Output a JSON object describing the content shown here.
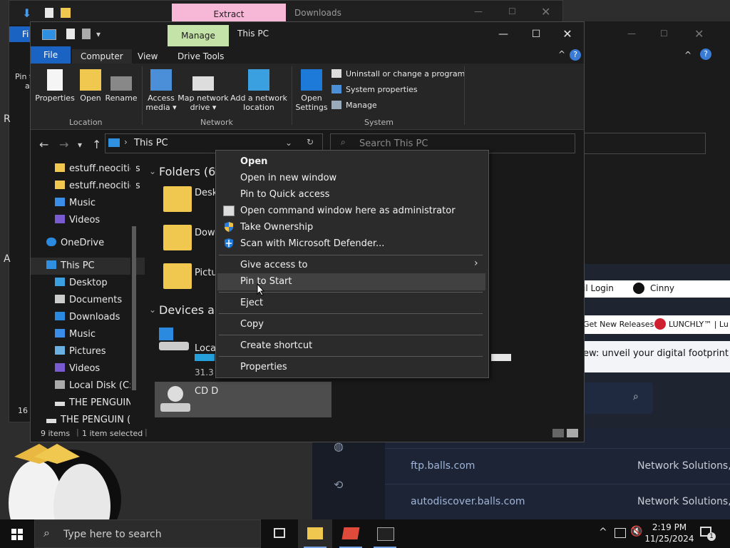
{
  "background": {
    "extract_tab": "Extract",
    "downloads_title": "Downloads",
    "browser": {
      "bookmark_login": "il Login",
      "bookmark_cinny": "Cinny",
      "bookmark_releases": "Get New Releases",
      "bookmark_lunchly": "LUNCHLY™ | Lu",
      "banner_text": "ew: unveil your digital footprint",
      "rows": [
        {
          "host": "ftp.balls.com",
          "org": "Network Solutions, L"
        },
        {
          "host": "autodiscover.balls.com",
          "org": "Network Solutions, L"
        }
      ],
      "dash": "-"
    }
  },
  "explorer": {
    "contextual_tab": "Manage",
    "title": "This PC",
    "menu": {
      "file": "File",
      "computer": "Computer",
      "view": "View",
      "drive_tools": "Drive Tools"
    },
    "ribbon": {
      "location": {
        "label": "Location",
        "properties": "Properties",
        "open": "Open",
        "rename": "Rename"
      },
      "network": {
        "label": "Network",
        "access_media_1": "Access",
        "access_media_2": "media ▾",
        "map_drive_1": "Map network",
        "map_drive_2": "drive ▾",
        "add_location_1": "Add a network",
        "add_location_2": "location"
      },
      "system": {
        "label": "System",
        "open_settings_1": "Open",
        "open_settings_2": "Settings",
        "uninstall": "Uninstall or change a program",
        "system_properties": "System properties",
        "manage": "Manage"
      }
    },
    "address": "This PC",
    "search_placeholder": "Search This PC",
    "nav": {
      "items": [
        "estuff.neocities",
        "estuff.neocities",
        "Music",
        "Videos",
        "OneDrive",
        "This PC",
        "Desktop",
        "Documents",
        "Downloads",
        "Music",
        "Pictures",
        "Videos",
        "Local Disk (C:)",
        "THE PENGUIN",
        "THE PENGUIN ("
      ]
    },
    "content": {
      "folders_header": "Folders (6)",
      "devices_header": "Devices and",
      "folder_desktop": "Deskt",
      "folder_downloads": "Down",
      "folder_pictures": "Pictu",
      "drive_local": "Loca",
      "drive_free": "31.3",
      "drive_cd": "CD D"
    },
    "status": {
      "items": "9 items",
      "selected": "1 item selected"
    }
  },
  "context_menu": {
    "items": {
      "open": "Open",
      "open_new_window": "Open in new window",
      "pin_quick": "Pin to Quick access",
      "cmd_admin": "Open command window here as administrator",
      "take_ownership": "Take Ownership",
      "scan_defender": "Scan with Microsoft Defender...",
      "give_access": "Give access to",
      "pin_start": "Pin to Start",
      "eject": "Eject",
      "copy": "Copy",
      "create_shortcut": "Create shortcut",
      "properties": "Properties"
    }
  },
  "taskbar": {
    "search_placeholder": "Type here to search",
    "time": "2:19 PM",
    "date": "11/25/2024",
    "notification_count": "1"
  },
  "left_edge": {
    "pin_label_1": "Pin t",
    "pin_label_2": "a",
    "fi": "Fi",
    "r": "R",
    "a": "A",
    "sixteen": "16"
  }
}
